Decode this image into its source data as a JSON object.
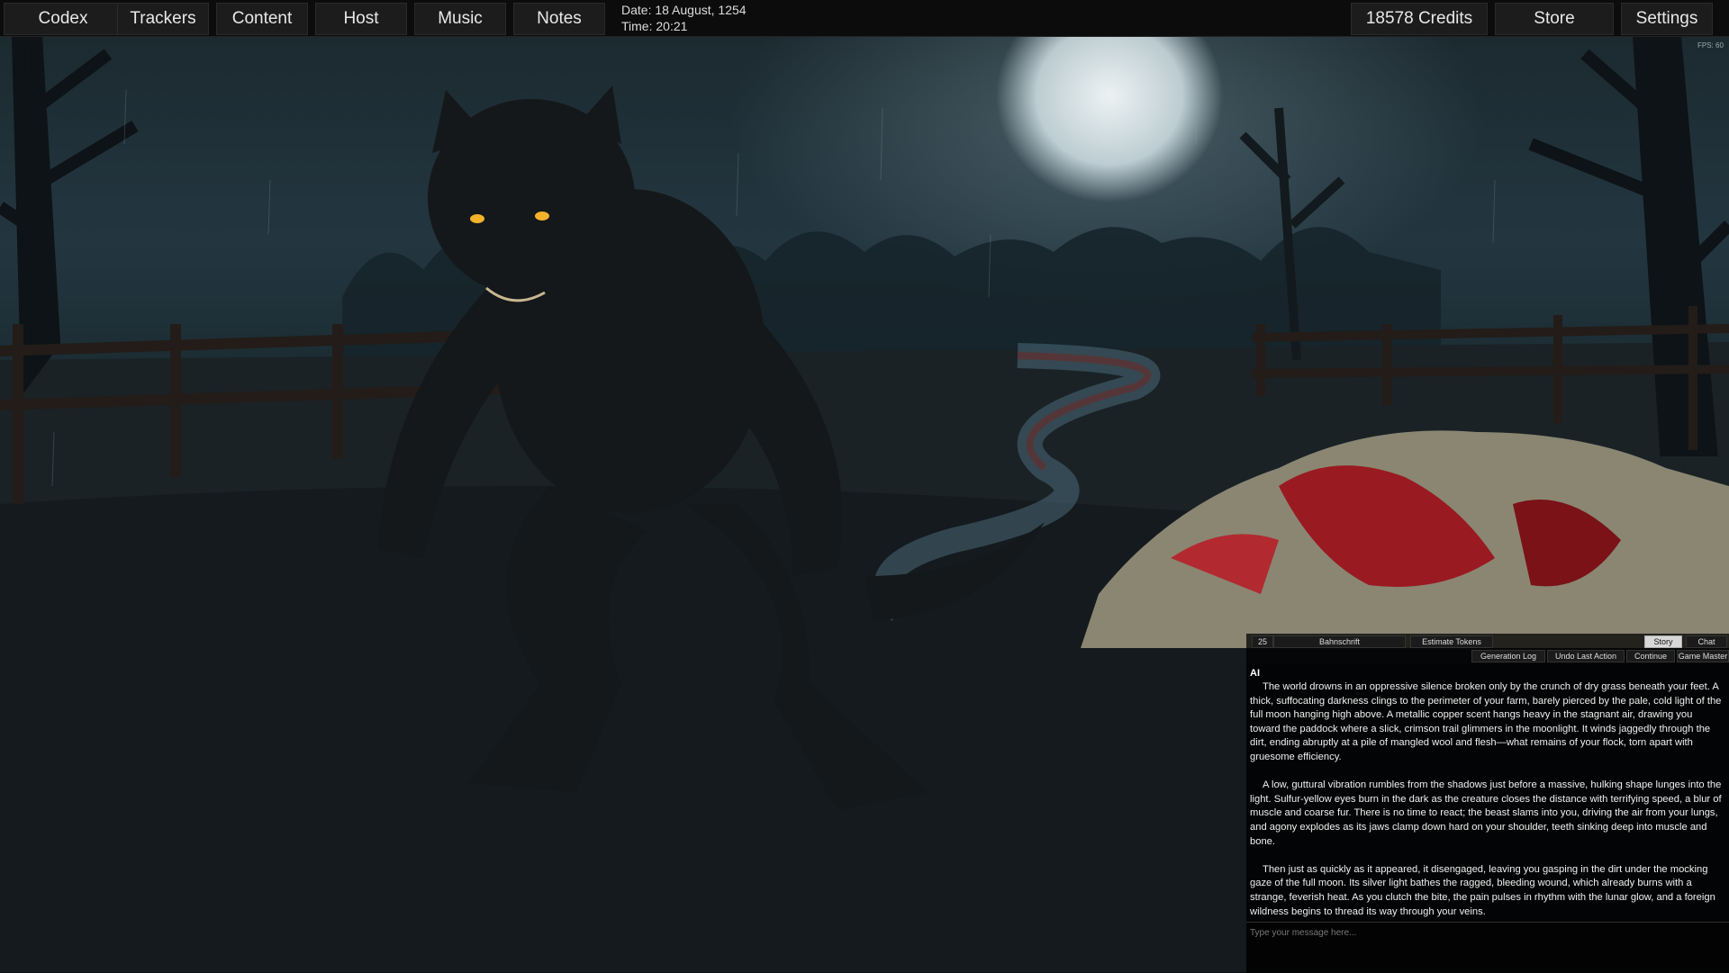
{
  "nav": {
    "left_tabs": [
      "Codex",
      "Trackers",
      "Content",
      "Host",
      "Music",
      "Notes"
    ],
    "date": "Date: 18 August, 1254",
    "time": "Time: 20:21",
    "credits": "18578 Credits",
    "store": "Store",
    "settings": "Settings"
  },
  "overlay": {
    "fps": "FPS: 60"
  },
  "panel": {
    "font_size": "25",
    "font_name": "Bahnschrift",
    "estimate_tokens": "Estimate Tokens",
    "mode_tabs": [
      "Story",
      "Chat"
    ],
    "active_mode": "Story",
    "actions": [
      "Generation Log",
      "Undo Last Action",
      "Continue",
      "Game Master"
    ],
    "speaker": "AI",
    "paragraphs": [
      "The world drowns in an oppressive silence broken only by the crunch of dry grass beneath your feet. A thick, suffocating darkness clings to the perimeter of your farm, barely pierced by the pale, cold light of the full moon hanging high above. A metallic copper scent hangs heavy in the stagnant air, drawing you toward the paddock where a slick, crimson trail glimmers in the moonlight. It winds jaggedly through the dirt, ending abruptly at a pile of mangled wool and flesh—what remains of your flock, torn apart with gruesome efficiency.",
      "A low, guttural vibration rumbles from the shadows just before a massive, hulking shape lunges into the light. Sulfur-yellow eyes burn in the dark as the creature closes the distance with terrifying speed, a blur of muscle and coarse fur. There is no time to react; the beast slams into you, driving the air from your lungs, and agony explodes as its jaws clamp down hard on your shoulder, teeth sinking deep into muscle and bone.",
      "Then just as quickly as it appeared, it disengaged, leaving you gasping in the dirt under the mocking gaze of the full moon. Its silver light bathes the ragged, bleeding wound, which already burns with a strange, feverish heat. As you clutch the bite, the pain pulses in rhythm with the lunar glow, and a foreign wildness begins to thread its way through your veins."
    ],
    "input_placeholder": "Type your message here..."
  },
  "colors": {
    "topbar_bg": "#0c0c0c",
    "tab_bg": "#1c1c1c",
    "panel_bg": "#000000",
    "moon": "#f2f6f6",
    "blood": "#9a1a22",
    "eyes": "#f2b22a"
  }
}
